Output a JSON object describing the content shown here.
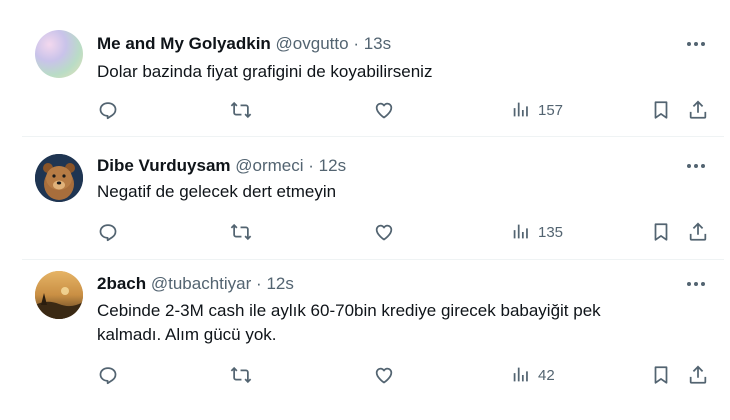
{
  "tweets": [
    {
      "name": "Me and My Golyadkin",
      "handle": "@ovgutto",
      "separator": "·",
      "time": "13s",
      "text": "Dolar bazinda fiyat grafigini de koyabilirseniz",
      "views": "157"
    },
    {
      "name": "Dibe Vurduysam",
      "handle": "@ormeci",
      "separator": "·",
      "time": "12s",
      "text": "Negatif de gelecek dert etmeyin",
      "views": "135"
    },
    {
      "name": "2bach",
      "handle": "@tubachtiyar",
      "separator": "·",
      "time": "12s",
      "text": "Cebinde 2-3M cash ile aylık 60-70bin krediye girecek babayiğit pek kalmadı. Alım gücü yok.",
      "views": "42"
    }
  ],
  "icons": {
    "more": "more-horizontal-icon",
    "reply": "reply-bubble-icon",
    "retweet": "retweet-arrows-icon",
    "like": "heart-icon",
    "views": "bar-chart-icon",
    "bookmark": "bookmark-icon",
    "share": "share-upload-icon"
  },
  "colors": {
    "text": "#0f1419",
    "secondary": "#536471",
    "divider": "#eff3f4",
    "background": "#ffffff"
  }
}
